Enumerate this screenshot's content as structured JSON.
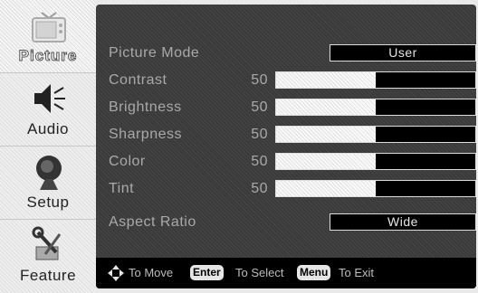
{
  "sidebar": {
    "items": [
      {
        "label": "Picture",
        "icon": "tv-icon"
      },
      {
        "label": "Audio",
        "icon": "speaker-icon"
      },
      {
        "label": "Setup",
        "icon": "satellite-dish-icon"
      },
      {
        "label": "Feature",
        "icon": "tools-icon"
      }
    ]
  },
  "picture": {
    "mode_label": "Picture Mode",
    "mode_value": "User",
    "settings": [
      {
        "label": "Contrast",
        "value": "50",
        "level": 0.5
      },
      {
        "label": "Brightness",
        "value": "50",
        "level": 0.5
      },
      {
        "label": "Sharpness",
        "value": "50",
        "level": 0.5
      },
      {
        "label": "Color",
        "value": "50",
        "level": 0.5
      },
      {
        "label": "Tint",
        "value": "50",
        "level": 0.5
      }
    ],
    "aspect_label": "Aspect Ratio",
    "aspect_value": "Wide"
  },
  "footer": {
    "move": "To Move",
    "enter_key": "Enter",
    "select": "To Select",
    "menu_key": "Menu",
    "exit": "To Exit"
  },
  "colors": {
    "panel": "#3a3a3a",
    "text": "#a9a9a9",
    "footer": "#000000"
  }
}
